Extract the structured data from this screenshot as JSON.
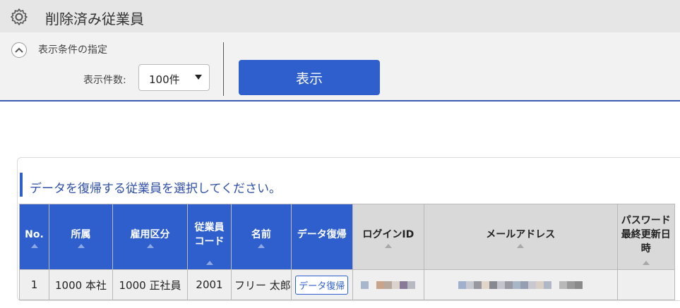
{
  "header": {
    "title": "削除済み従業員",
    "icon": "gear-icon"
  },
  "filter": {
    "section_label": "表示条件の指定",
    "count_label": "表示件数:",
    "count_value": "100件",
    "show_button": "表示"
  },
  "table": {
    "instruction": "データを復帰する従業員を選択してください。",
    "columns": [
      {
        "label": "No."
      },
      {
        "label": "所属"
      },
      {
        "label": "雇用区分"
      },
      {
        "label": "従業員コード"
      },
      {
        "label": "名前"
      },
      {
        "label": "データ復帰"
      },
      {
        "label": "ログインID"
      },
      {
        "label": "メールアドレス"
      },
      {
        "label": "パスワード最終更新日時"
      }
    ],
    "rows": [
      {
        "no": "1",
        "dept": "1000 本社",
        "employment": "1000 正社員",
        "code": "2001",
        "name": "フリー 太郎",
        "restore": "データ復帰",
        "password_updated": ""
      }
    ]
  },
  "colors": {
    "accent": "#2e5fcc",
    "highlight": "#e8141a",
    "header_gray": "#d9d9d9"
  }
}
